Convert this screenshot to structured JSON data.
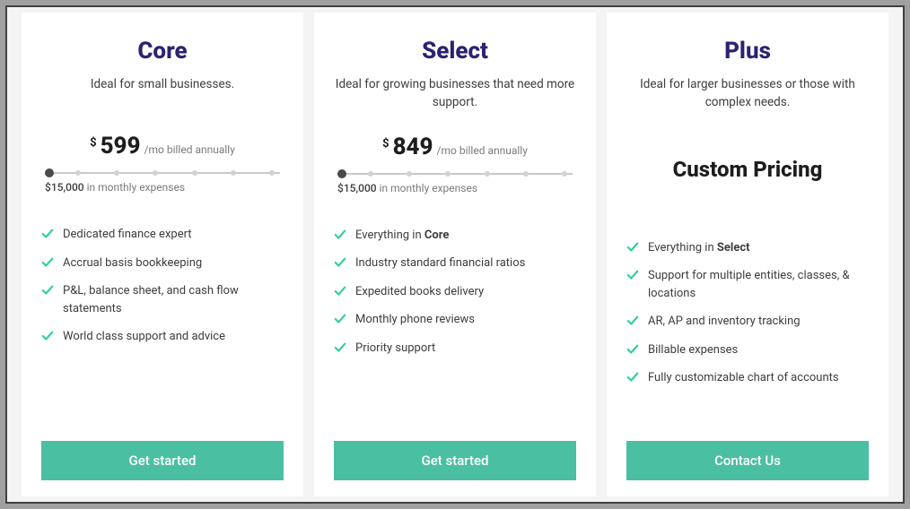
{
  "colors": {
    "accent_button": "#4bbfa1",
    "title_color": "#2a2370",
    "check_color": "#2fce9b"
  },
  "plans": [
    {
      "key": "core",
      "title": "Core",
      "subtitle": "Ideal for small businesses.",
      "price_currency": "$",
      "price_amount": "599",
      "price_period": "/mo billed annually",
      "expenses_amount": "$15,000",
      "expenses_label": "in monthly expenses",
      "has_slider": true,
      "custom_label": null,
      "cta": "Get started",
      "features": [
        {
          "text": "Dedicated finance expert"
        },
        {
          "text": "Accrual basis bookkeeping"
        },
        {
          "text": "P&L, balance sheet, and cash flow statements"
        },
        {
          "text": "World class support and advice"
        }
      ]
    },
    {
      "key": "select",
      "title": "Select",
      "subtitle": "Ideal for growing businesses that need more support.",
      "price_currency": "$",
      "price_amount": "849",
      "price_period": "/mo billed annually",
      "expenses_amount": "$15,000",
      "expenses_label": "in monthly expenses",
      "has_slider": true,
      "custom_label": null,
      "cta": "Get started",
      "features": [
        {
          "prefix": "Everything in ",
          "bold": "Core"
        },
        {
          "text": "Industry standard financial ratios"
        },
        {
          "text": "Expedited books delivery"
        },
        {
          "text": "Monthly phone reviews"
        },
        {
          "text": "Priority support"
        }
      ]
    },
    {
      "key": "plus",
      "title": "Plus",
      "subtitle": "Ideal for larger businesses or those with complex needs.",
      "price_currency": null,
      "price_amount": null,
      "price_period": null,
      "expenses_amount": null,
      "expenses_label": null,
      "has_slider": false,
      "custom_label": "Custom Pricing",
      "cta": "Contact Us",
      "features": [
        {
          "prefix": "Everything in ",
          "bold": "Select"
        },
        {
          "text": "Support for multiple entities, classes, & locations"
        },
        {
          "text": "AR, AP and inventory tracking"
        },
        {
          "text": "Billable expenses"
        },
        {
          "text": "Fully customizable chart of accounts"
        }
      ]
    }
  ]
}
